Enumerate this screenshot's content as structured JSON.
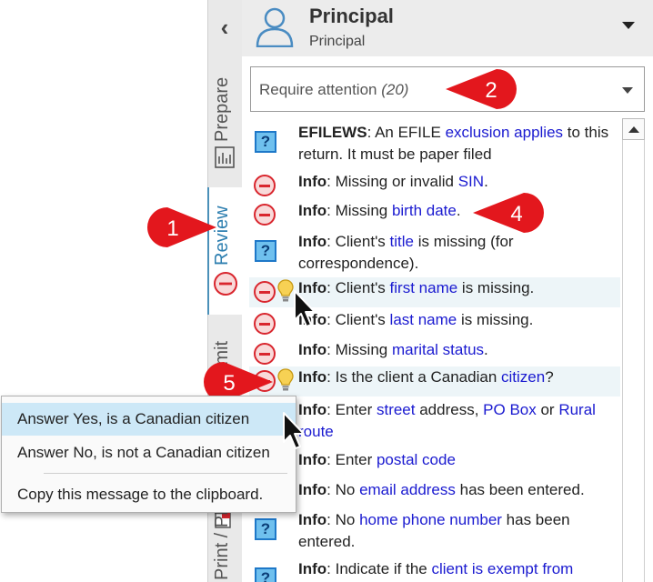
{
  "tabs": {
    "prepare": "Prepare",
    "review": "Review",
    "transmit": "Transmit",
    "print": "Print / PDF"
  },
  "header": {
    "name": "Principal",
    "subtitle": "Principal"
  },
  "filter": {
    "label": "Require attention",
    "count": "(20)"
  },
  "messages": [
    {
      "icon": "help-icon",
      "parts": [
        [
          "b",
          "EFILEWS"
        ],
        [
          "t",
          ": An EFILE "
        ],
        [
          "l",
          "exclusion applies"
        ],
        [
          "t",
          " to this return. It must be paper filed"
        ]
      ]
    },
    {
      "icon": "error-icon",
      "parts": [
        [
          "b",
          "Info"
        ],
        [
          "t",
          ": Missing or invalid "
        ],
        [
          "l",
          "SIN"
        ],
        [
          "t",
          "."
        ]
      ]
    },
    {
      "icon": "error-icon",
      "parts": [
        [
          "b",
          "Info"
        ],
        [
          "t",
          ": Missing "
        ],
        [
          "l",
          "birth date"
        ],
        [
          "t",
          "."
        ]
      ]
    },
    {
      "icon": "help-icon",
      "parts": [
        [
          "b",
          "Info"
        ],
        [
          "t",
          ": Client's "
        ],
        [
          "l",
          "title"
        ],
        [
          "t",
          " is missing (for correspondence)."
        ]
      ]
    },
    {
      "icon": "error-icon",
      "bulb": true,
      "parts": [
        [
          "b",
          "Info"
        ],
        [
          "t",
          ": Client's "
        ],
        [
          "l",
          "first name"
        ],
        [
          "t",
          " is missing."
        ]
      ]
    },
    {
      "icon": "error-icon",
      "parts": [
        [
          "b",
          "Info"
        ],
        [
          "t",
          ": Client's "
        ],
        [
          "l",
          "last name"
        ],
        [
          "t",
          " is missing."
        ]
      ]
    },
    {
      "icon": "error-icon",
      "parts": [
        [
          "b",
          "Info"
        ],
        [
          "t",
          ": Missing "
        ],
        [
          "l",
          "marital status"
        ],
        [
          "t",
          "."
        ]
      ]
    },
    {
      "icon": "error-icon",
      "bulb": true,
      "parts": [
        [
          "b",
          "Info"
        ],
        [
          "t",
          ": Is the client a Canadian "
        ],
        [
          "l",
          "citizen"
        ],
        [
          "t",
          "?"
        ]
      ]
    },
    {
      "icon": "error-icon",
      "parts": [
        [
          "b",
          "Info"
        ],
        [
          "t",
          ": Enter "
        ],
        [
          "l",
          "street"
        ],
        [
          "t",
          " address, "
        ],
        [
          "l",
          "PO Box"
        ],
        [
          "t",
          " or "
        ],
        [
          "l",
          "Rural route"
        ]
      ]
    },
    {
      "icon": "error-icon",
      "parts": [
        [
          "b",
          "Info"
        ],
        [
          "t",
          ": Enter "
        ],
        [
          "l",
          "postal code"
        ]
      ]
    },
    {
      "icon": "error-icon",
      "parts": [
        [
          "b",
          "Info"
        ],
        [
          "t",
          ": No "
        ],
        [
          "l",
          "email address"
        ],
        [
          "t",
          " has been entered."
        ]
      ]
    },
    {
      "icon": "help-icon",
      "parts": [
        [
          "b",
          "Info"
        ],
        [
          "t",
          ": No "
        ],
        [
          "l",
          "home phone number"
        ],
        [
          "t",
          " has been entered."
        ]
      ]
    },
    {
      "icon": "help-icon",
      "parts": [
        [
          "b",
          "Info"
        ],
        [
          "t",
          ": Indicate if the "
        ],
        [
          "l",
          "client is exempt from"
        ]
      ]
    }
  ],
  "context_menu": {
    "yes": "Answer Yes, is a Canadian citizen",
    "no": "Answer No, is not a Canadian citizen",
    "copy": "Copy this message to the clipboard."
  },
  "callouts": [
    "1",
    "2",
    "4",
    "5"
  ],
  "colors": {
    "link": "#1a1ad0",
    "callout": "#e3171d",
    "error": "#d9262e",
    "help": "#6fc0ee",
    "active_tab": "#2e7fb0",
    "menu_highlight": "#cde8f7"
  }
}
